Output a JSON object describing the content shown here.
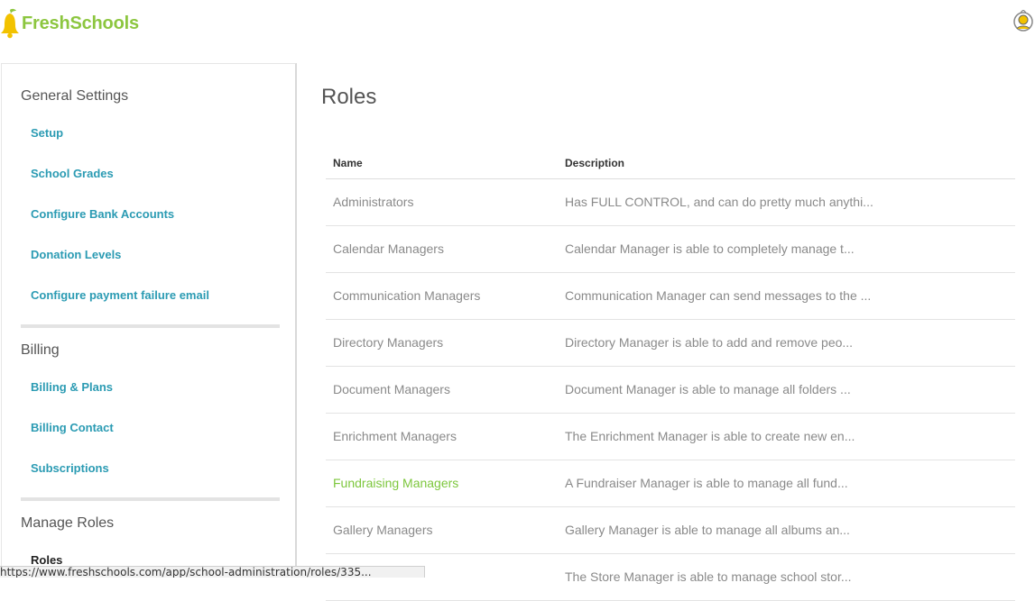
{
  "brand": {
    "part1": "Fresh",
    "part2": "Schools"
  },
  "sidebar": {
    "sections": [
      {
        "title": "General Settings",
        "items": [
          "Setup",
          "School Grades",
          "Configure Bank Accounts",
          "Donation Levels",
          "Configure payment failure email"
        ]
      },
      {
        "title": "Billing",
        "items": [
          "Billing & Plans",
          "Billing Contact",
          "Subscriptions"
        ]
      },
      {
        "title": "Manage Roles",
        "items": [
          "Roles"
        ]
      }
    ]
  },
  "main": {
    "title": "Roles",
    "columns": {
      "name": "Name",
      "description": "Description"
    },
    "rows": [
      {
        "name": "Administrators",
        "description": "Has FULL CONTROL, and can do pretty much anythi..."
      },
      {
        "name": "Calendar Managers",
        "description": "Calendar Manager is able to completely manage t..."
      },
      {
        "name": "Communication Managers",
        "description": "Communication Manager can send messages to the ..."
      },
      {
        "name": "Directory Managers",
        "description": "Directory Manager is able to add and remove peo..."
      },
      {
        "name": "Document Managers",
        "description": "Document Manager is able to manage all folders ..."
      },
      {
        "name": "Enrichment Managers",
        "description": "The Enrichment Manager is able to create new en..."
      },
      {
        "name": "Fundraising Managers",
        "description": "A Fundraiser Manager is able to manage all fund..."
      },
      {
        "name": "Gallery Managers",
        "description": "Gallery Manager is able to manage all albums an..."
      },
      {
        "name": "",
        "description": "The Store Manager is able to manage school stor..."
      }
    ]
  },
  "statusbar": {
    "url": "https://www.freshschools.com/app/school-administration/roles/335..."
  },
  "colors": {
    "brand_green": "#8cc63f",
    "link_teal": "#2b9bb3",
    "highlight_green": "#7dc73d"
  }
}
